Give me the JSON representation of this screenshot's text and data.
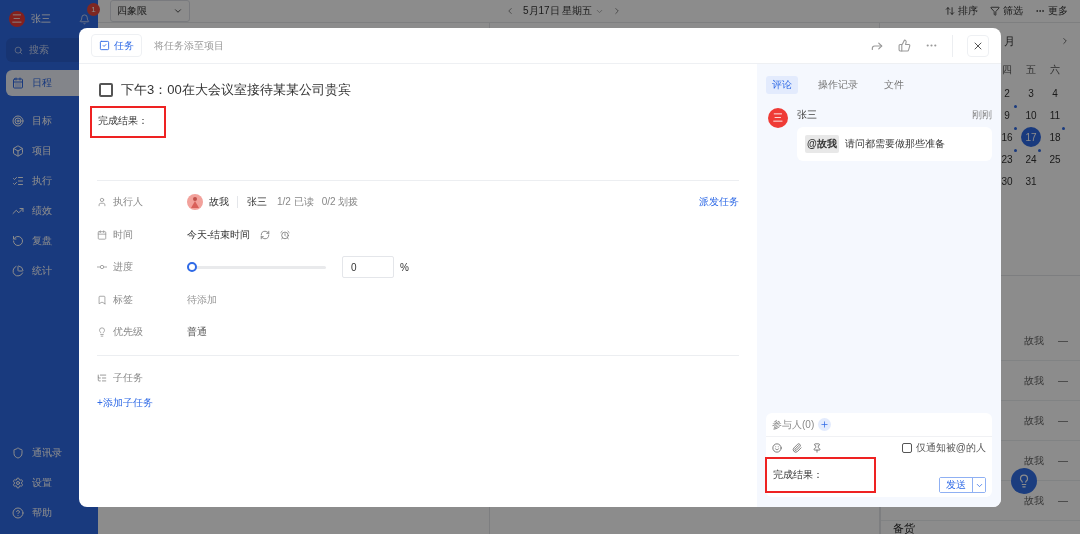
{
  "sidebar": {
    "user": {
      "avatar": "三",
      "name": "张三",
      "badge": "1"
    },
    "search": {
      "placeholder": "搜索"
    },
    "items": [
      {
        "label": "日程",
        "selected": true
      },
      {
        "label": "目标",
        "selected": false
      },
      {
        "label": "项目",
        "selected": false
      },
      {
        "label": "执行",
        "selected": false
      },
      {
        "label": "绩效",
        "selected": false
      },
      {
        "label": "复盘",
        "selected": false
      },
      {
        "label": "统计",
        "selected": false
      }
    ],
    "bottom_items": [
      {
        "label": "通讯录"
      },
      {
        "label": "设置"
      },
      {
        "label": "帮助"
      }
    ]
  },
  "toolbar": {
    "view": "四象限",
    "date": "5月17日 星期五",
    "actions": [
      {
        "label": "排序"
      },
      {
        "label": "筛选"
      },
      {
        "label": "更多"
      }
    ]
  },
  "calendar": {
    "month_title": "月",
    "weekdays": [
      "四",
      "五",
      "六"
    ],
    "weeks": [
      [
        {
          "day": "2",
          "selected": false,
          "has_event": false
        },
        {
          "day": "3",
          "selected": false,
          "has_event": false
        },
        {
          "day": "4",
          "selected": false,
          "has_event": false
        }
      ],
      [
        {
          "day": "9",
          "selected": false,
          "has_event": true
        },
        {
          "day": "10",
          "selected": false,
          "has_event": false
        },
        {
          "day": "11",
          "selected": false,
          "has_event": false
        }
      ],
      [
        {
          "day": "16",
          "selected": false,
          "has_event": true
        },
        {
          "day": "17",
          "selected": true,
          "has_event": false
        },
        {
          "day": "18",
          "selected": false,
          "has_event": true
        }
      ],
      [
        {
          "day": "23",
          "selected": false,
          "has_event": true
        },
        {
          "day": "24",
          "selected": false,
          "has_event": true
        },
        {
          "day": "25",
          "selected": false,
          "has_event": false
        }
      ],
      [
        {
          "day": "30",
          "selected": false,
          "has_event": false
        },
        {
          "day": "31",
          "selected": false,
          "has_event": false
        }
      ]
    ]
  },
  "task_list": {
    "rows": [
      {
        "assignee": "故我",
        "priority": "—"
      },
      {
        "assignee": "故我",
        "priority": "—"
      },
      {
        "assignee": "故我",
        "priority": "—"
      },
      {
        "assignee": "故我",
        "priority": "—"
      },
      {
        "assignee": "故我",
        "priority": "—"
      }
    ],
    "next_group": "备货"
  },
  "task_modal": {
    "type_tab": "任务",
    "add_to_project": "将任务添至项目",
    "done": false,
    "title": "下午3：00在大会议室接待某某公司贵宾",
    "result": {
      "text": "完成结果：",
      "highlighted": true
    },
    "fields": [
      {
        "kind": "assignee",
        "label": "执行人",
        "creator": "故我",
        "name": "张三",
        "read": "1/2 已读",
        "overdue": "0/2 划拨",
        "action": "派发任务"
      },
      {
        "kind": "time",
        "label": "时间",
        "value": "今天-结束时间"
      },
      {
        "kind": "progress",
        "label": "进度",
        "level": 0,
        "value": "0",
        "unit": "%"
      },
      {
        "kind": "text",
        "label": "标签",
        "placeholder": "待添加"
      },
      {
        "kind": "text",
        "label": "优先级",
        "value": "普通"
      }
    ],
    "subtasks": {
      "label": "子任务",
      "add": "+添加子任务"
    }
  },
  "comments_panel": {
    "tabs": [
      {
        "label": "评论",
        "selected": true
      },
      {
        "label": "操作记录",
        "selected": false
      },
      {
        "label": "文件",
        "selected": false
      }
    ],
    "comments": [
      {
        "avatar": "三",
        "author": "张三",
        "time": "刚刚",
        "mention": "@故我",
        "text": "请问都需要做那些准备"
      }
    ],
    "composer": {
      "participants": "参与人(0)",
      "notify": {
        "label": "仅通知被@的人",
        "checked": false
      },
      "value": "完成结果：",
      "highlighted": true,
      "send": "发送"
    }
  }
}
